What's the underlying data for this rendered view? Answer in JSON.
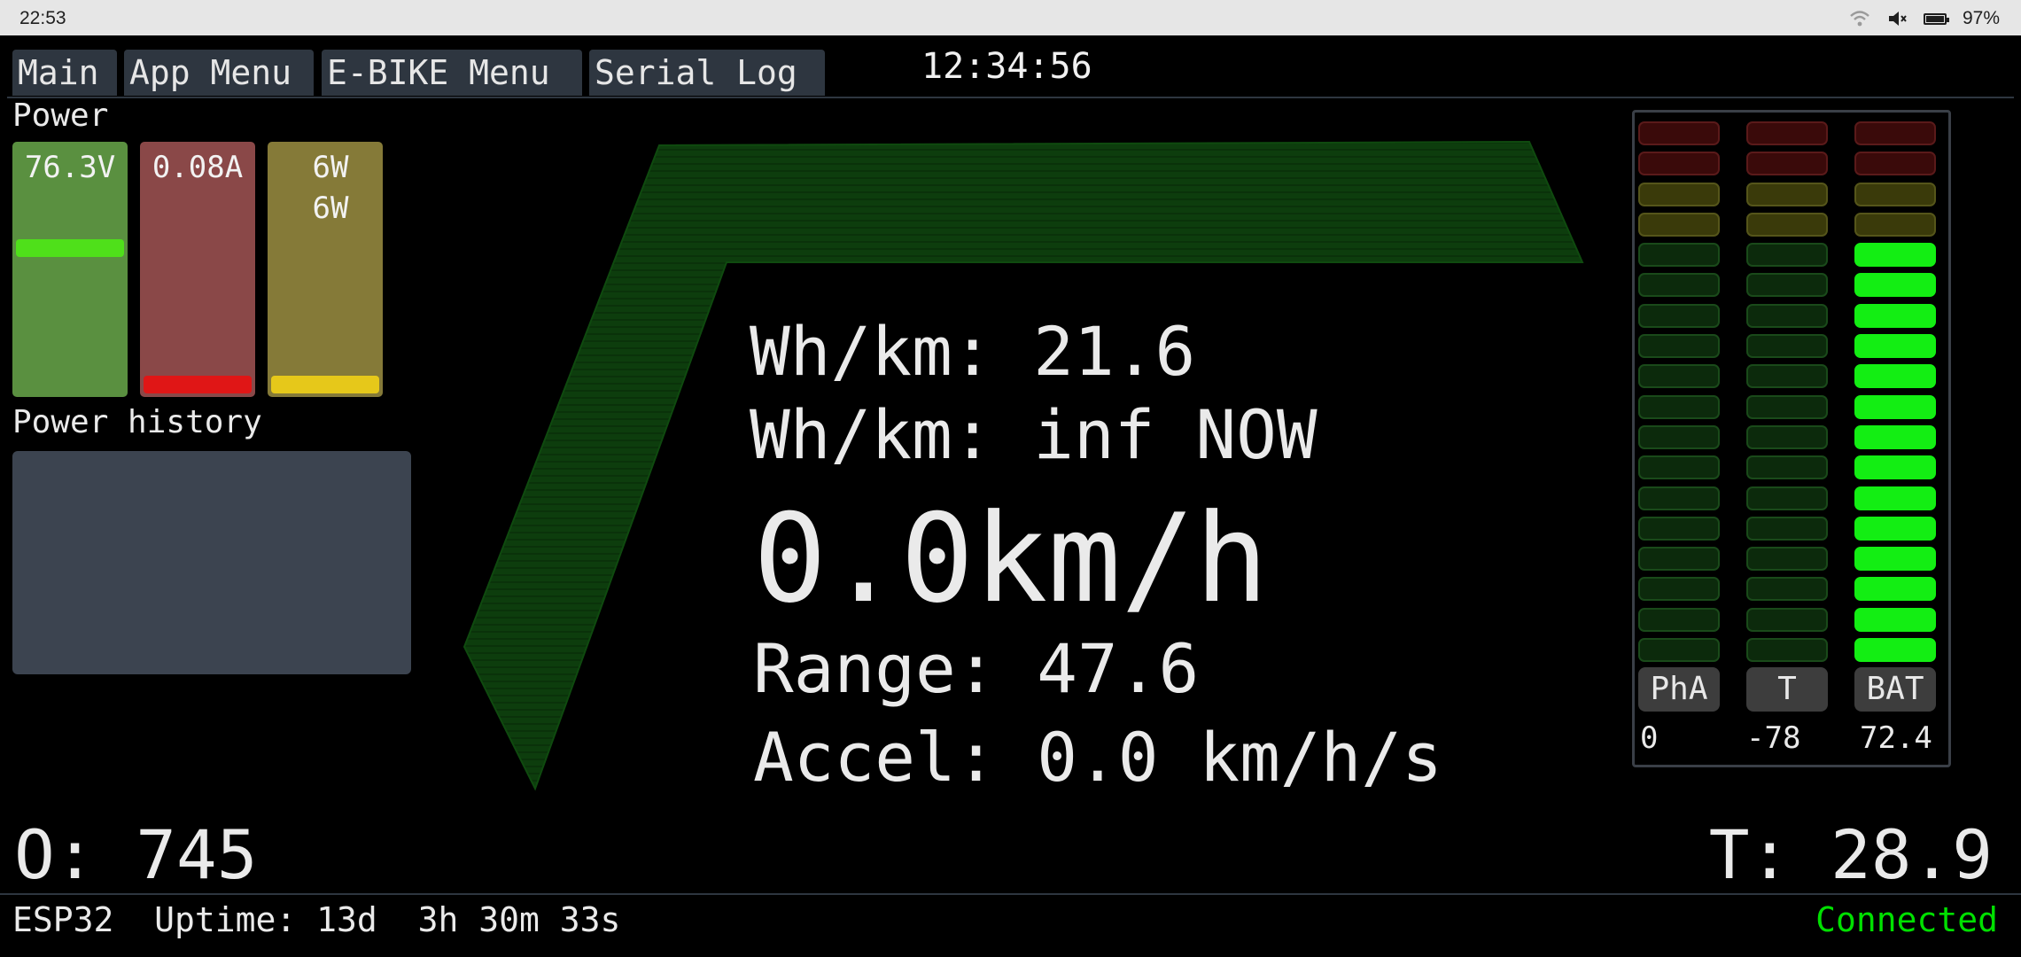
{
  "statusbar": {
    "time": "22:53",
    "battery": "97%",
    "icons": [
      "wifi-icon",
      "mute-icon",
      "battery-icon"
    ]
  },
  "tabs": [
    "Main",
    "App Menu",
    "E-BIKE Menu",
    "Serial Log"
  ],
  "header_time": "12:34:56",
  "power": {
    "title": "Power",
    "voltage": {
      "text": "76.3V",
      "color": "#5a9040",
      "level_color": "#4fe01a"
    },
    "current": {
      "text": "0.08A",
      "color": "#8a4848",
      "level_color": "#e01616"
    },
    "watts": {
      "line1": "6W",
      "line2": "6W",
      "color": "#857a38",
      "level_color": "#e6c81a"
    }
  },
  "history": {
    "title": "Power history"
  },
  "metrics": {
    "wh_km": "Wh/km: 21.6",
    "wh_km_now": "Wh/km: inf NOW",
    "speed": "0.0km/h",
    "range": "Range: 47.6",
    "accel": "Accel: 0.0 km/h/s"
  },
  "gauges": {
    "segments": 18,
    "columns": [
      {
        "label": "PhA",
        "value": "0",
        "lit": 0
      },
      {
        "label": "T",
        "value": "-78",
        "lit": 0
      },
      {
        "label": "BAT",
        "value": "72.4",
        "lit": 14
      }
    ],
    "colors": {
      "red_off": "#3a0a0a",
      "yellow_off": "#3a3a0a",
      "green_off": "#0c2a0c",
      "green_on": "#13ee13"
    }
  },
  "odometer": "O: 745",
  "temperature": "T: 28.9",
  "footer": {
    "device": "ESP32",
    "uptime": "Uptime: 13d  3h 30m 33s",
    "status": "Connected"
  }
}
